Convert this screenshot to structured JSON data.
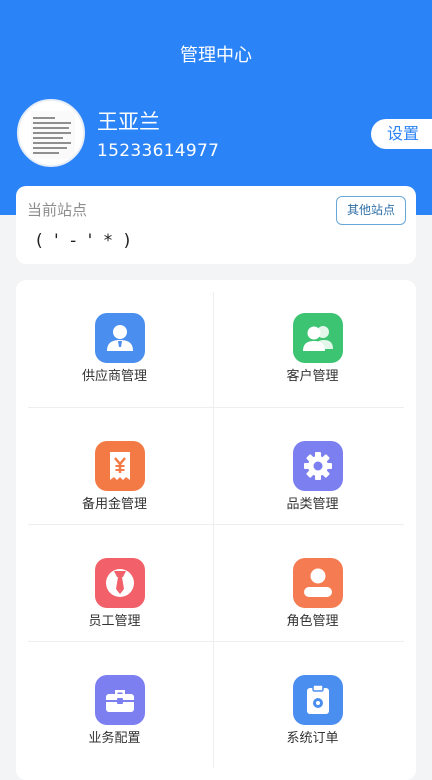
{
  "header": {
    "title": "管理中心",
    "background": "#2a83f7"
  },
  "user": {
    "name": "王亚兰",
    "phone": "15233614977",
    "settings_label": "设置"
  },
  "station": {
    "label": "当前站点",
    "value": "( ' - ' * )",
    "other_button_label": "其他站点"
  },
  "menu": {
    "items": [
      {
        "label": "供应商管理",
        "icon": "supplier-person-icon",
        "color": "#4a8ff0"
      },
      {
        "label": "客户管理",
        "icon": "customers-icon",
        "color": "#3cc472"
      },
      {
        "label": "备用金管理",
        "icon": "petty-cash-yen-icon",
        "color": "#f47a45"
      },
      {
        "label": "品类管理",
        "icon": "gear-icon",
        "color": "#7b7ff0"
      },
      {
        "label": "员工管理",
        "icon": "employee-tie-icon",
        "color": "#f2606a"
      },
      {
        "label": "角色管理",
        "icon": "role-person-icon",
        "color": "#f57c52"
      },
      {
        "label": "业务配置",
        "icon": "briefcase-icon",
        "color": "#7b7ff0"
      },
      {
        "label": "系统订单",
        "icon": "order-clipboard-icon",
        "color": "#4a8ff0"
      }
    ]
  }
}
